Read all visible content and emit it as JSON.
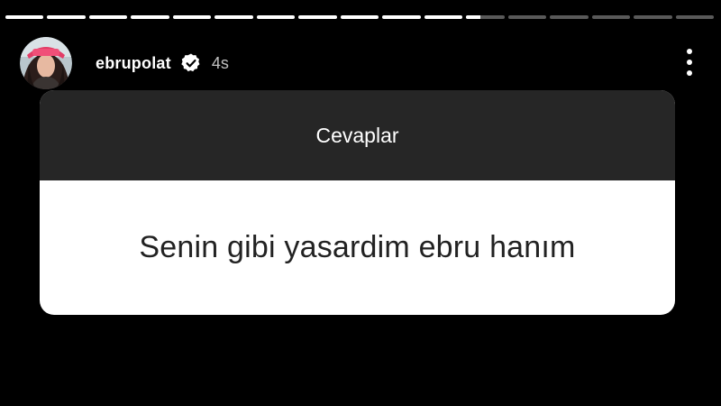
{
  "story": {
    "progress": {
      "segments": [
        1,
        1,
        1,
        1,
        1,
        1,
        1,
        1,
        1,
        1,
        1,
        0.37,
        0,
        0,
        0,
        0,
        0
      ]
    },
    "header": {
      "avatar_icon": "profile-photo",
      "username": "ebrupolat",
      "verified_icon": "verified-badge-icon",
      "time": "4s",
      "more_icon": "more-vertical-icon"
    },
    "question_card": {
      "title": "Cevaplar",
      "answer": "Senin gibi yasardim ebru hanım"
    }
  },
  "colors": {
    "background": "#000000",
    "card_header": "#262626",
    "card_body": "#ffffff"
  }
}
